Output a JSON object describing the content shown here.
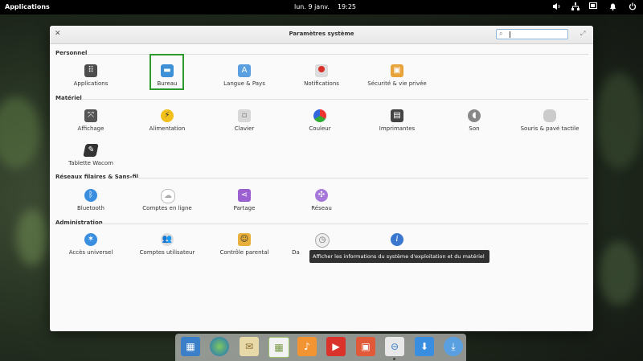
{
  "panel": {
    "applications_label": "Applications",
    "date": "lun. 9 janv.",
    "time": "19:25",
    "indicators": [
      "volume-icon",
      "network-icon",
      "battery-icon",
      "notifications-icon",
      "power-icon"
    ]
  },
  "window": {
    "title": "Paramètres système",
    "search_value": ""
  },
  "sections": {
    "personal": {
      "label": "Personnel",
      "items": [
        "Applications",
        "Bureau",
        "Langue & Pays",
        "Notifications",
        "Sécurité & vie privée"
      ]
    },
    "hardware": {
      "label": "Matériel",
      "items": [
        "Affichage",
        "Alimentation",
        "Clavier",
        "Couleur",
        "Imprimantes",
        "Son",
        "Souris & pavé tactile",
        "Tablette Wacom"
      ]
    },
    "network": {
      "label": "Réseaux filaires & Sans-fil",
      "items": [
        "Bluetooth",
        "Comptes en ligne",
        "Partage",
        "Réseau"
      ]
    },
    "admin": {
      "label": "Administration",
      "items": [
        "Accès universel",
        "Comptes utilisateur",
        "Contrôle parental",
        "Da",
        "À propos"
      ]
    }
  },
  "tooltip": "Afficher les informations du système d'exploitation et du matériel",
  "dock": [
    "multitasking",
    "web-browser",
    "mail",
    "calendar",
    "music",
    "videos",
    "photos",
    "settings",
    "downloads",
    "software-center"
  ],
  "colors": {
    "selection_border": "#2e9a2e",
    "panel_bg": "#000000"
  }
}
